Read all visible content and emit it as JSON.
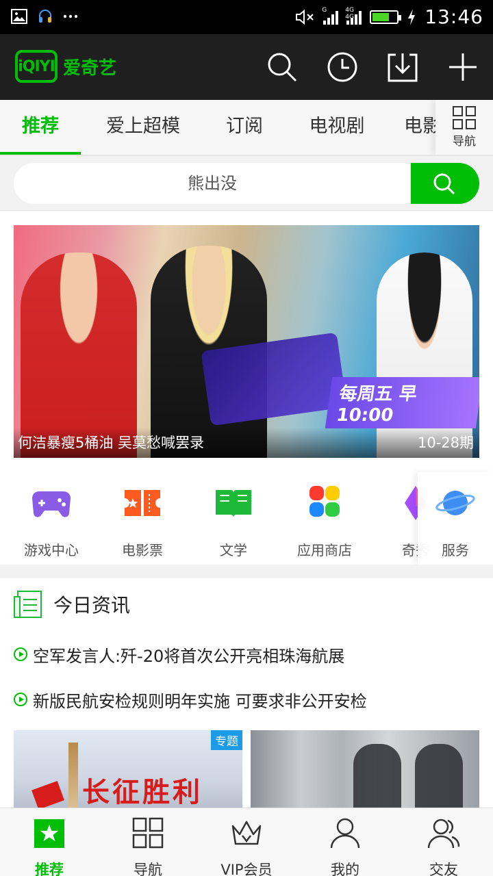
{
  "colors": {
    "brand_green": "#00be06",
    "header_bg": "#1f1f1f",
    "tag_blue": "#1e9be8"
  },
  "status_bar": {
    "time": "13:46",
    "network_1": "G",
    "network_2": "4G 4G",
    "battery_level": 0.7,
    "icons": [
      "image-icon",
      "headset-icon",
      "more-icon",
      "mute-icon",
      "signal-icon",
      "battery-icon",
      "charging-icon"
    ]
  },
  "app_bar": {
    "logo_mark": "iQIYI",
    "logo_text": "爱奇艺",
    "actions": [
      "search-icon",
      "history-icon",
      "download-icon",
      "add-icon"
    ]
  },
  "tabs": {
    "items": [
      {
        "label": "推荐",
        "active": true
      },
      {
        "label": "爱上超模",
        "active": false
      },
      {
        "label": "订阅",
        "active": false
      },
      {
        "label": "电视剧",
        "active": false
      },
      {
        "label": "电影",
        "active": false
      }
    ],
    "nav_label": "导航"
  },
  "search": {
    "placeholder": "熊出没"
  },
  "banner": {
    "caption": "何洁暴瘦5桶油 吴莫愁喊罢录",
    "episode": "10-28期",
    "schedule": "每周五 早10:00"
  },
  "shortcuts": [
    {
      "label": "游戏中心",
      "icon": "gamepad-icon"
    },
    {
      "label": "电影票",
      "icon": "movie-ticket-icon"
    },
    {
      "label": "文学",
      "icon": "book-icon"
    },
    {
      "label": "应用商店",
      "icon": "app-store-icon"
    },
    {
      "label": "奇秀",
      "icon": "qixiu-icon"
    },
    {
      "label": "服务",
      "icon": "planet-icon"
    }
  ],
  "news": {
    "title": "今日资讯",
    "items": [
      "空军发言人:歼-20将首次公开亮相珠海航展",
      "新版民航安检规则明年实施 可要求非公开安检"
    ],
    "thumb1_text": "长征胜利",
    "thumb1_tag": "专题"
  },
  "bottom_nav": [
    {
      "label": "推荐",
      "icon": "star-icon",
      "active": true
    },
    {
      "label": "导航",
      "icon": "grid-icon",
      "active": false
    },
    {
      "label": "VIP会员",
      "icon": "crown-icon",
      "active": false
    },
    {
      "label": "我的",
      "icon": "person-icon",
      "active": false
    },
    {
      "label": "交友",
      "icon": "friends-icon",
      "active": false
    }
  ]
}
